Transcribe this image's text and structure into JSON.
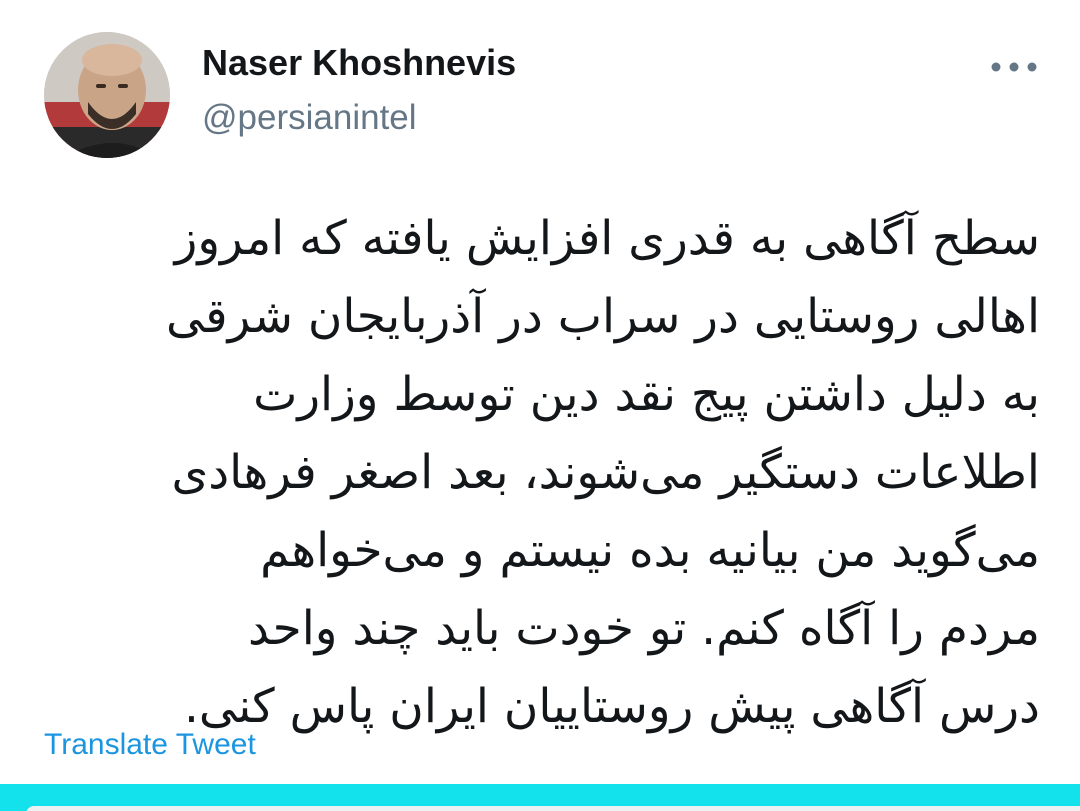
{
  "tweet": {
    "author": {
      "display_name": "Naser Khoshnevis",
      "handle": "@persianintel",
      "avatar_icon": "profile-photo"
    },
    "more_icon": "more-horizontal-icon",
    "text_lines": [
      "سطح آگاهی به قدری افزایش یافته که امروز",
      "اهالی روستایی در سراب در آذربایجان شرقی",
      "به دلیل داشتن پیج نقد دین توسط وزارت",
      "اطلاعات دستگیر می‌شوند، بعد اصغر فرهادی",
      "می‌گوید من بیانیه بده نیستم و می‌خواهم",
      "مردم را آگاه کنم. تو خودت باید چند واحد",
      "درس آگاهی پیش روستاییان ایران پاس کنی."
    ],
    "translate_label": "Translate Tweet"
  },
  "colors": {
    "text_primary": "#14171a",
    "text_secondary": "#657786",
    "link": "#1b95e0",
    "bottom_bar": "#13e2ec"
  }
}
